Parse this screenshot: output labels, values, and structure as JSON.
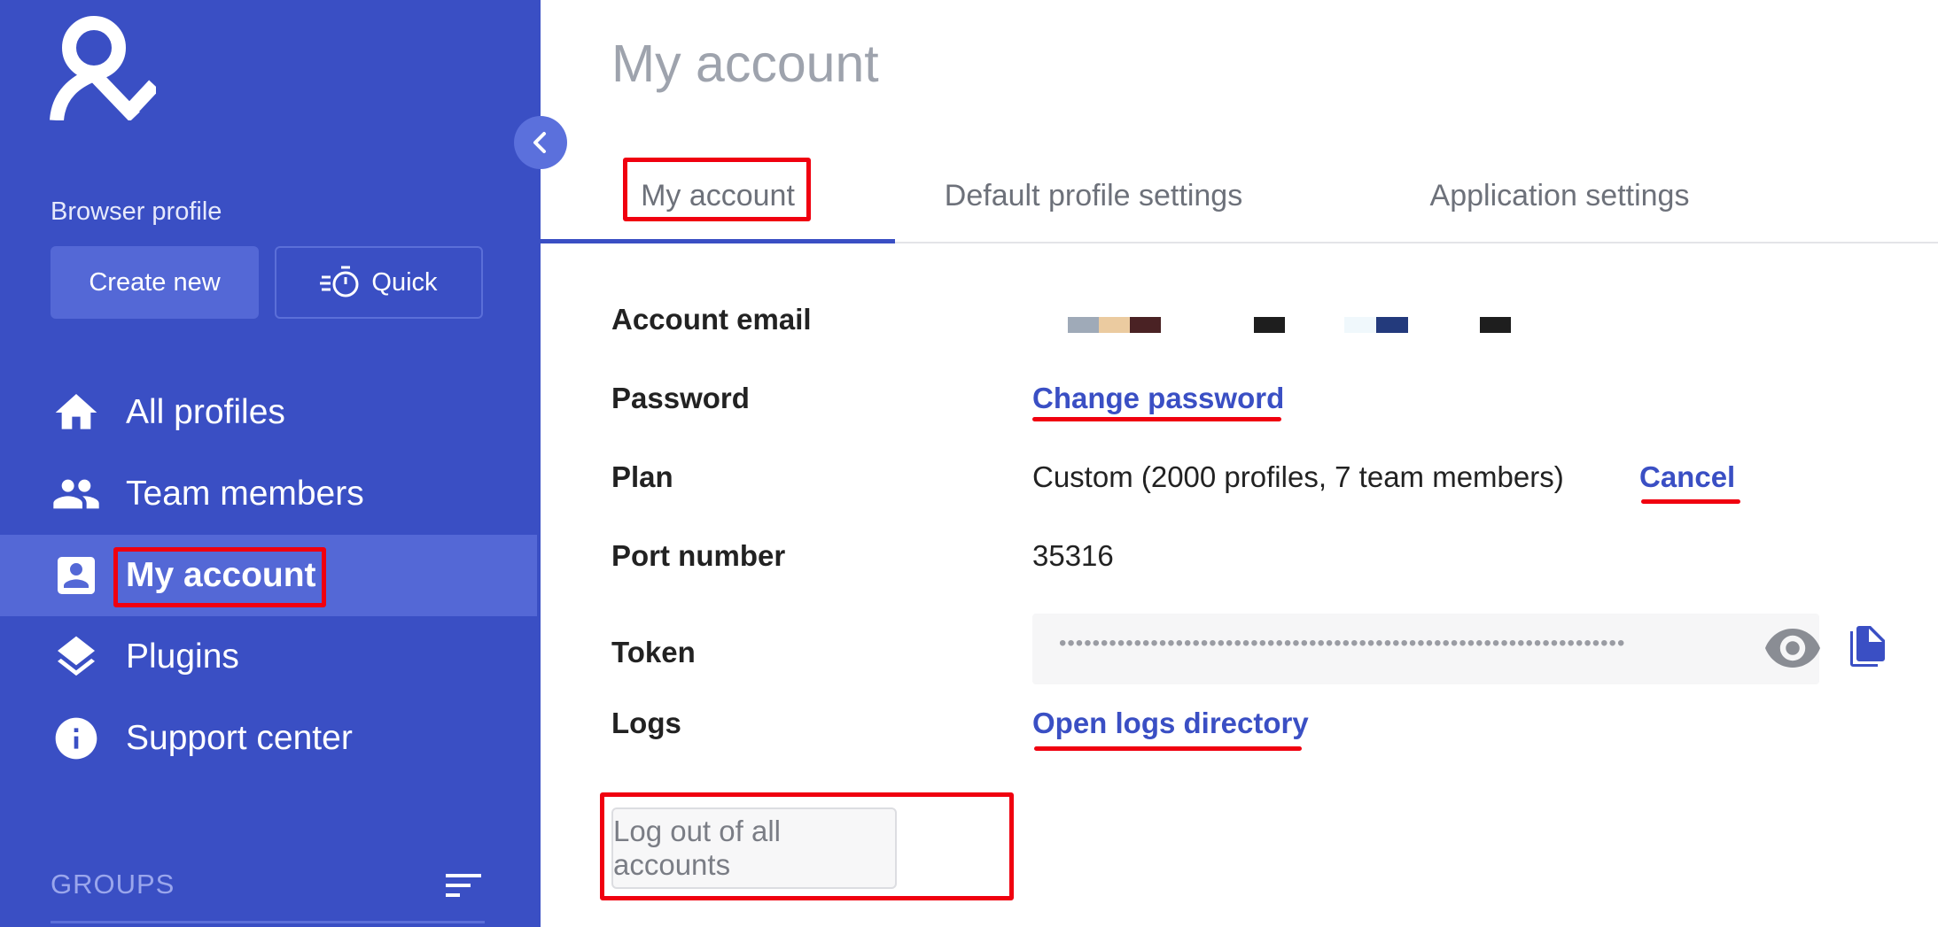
{
  "sidebar": {
    "section_label": "Browser profile",
    "create_new_label": "Create new",
    "quick_label": "Quick",
    "nav": [
      {
        "label": "All profiles",
        "icon": "home-icon"
      },
      {
        "label": "Team members",
        "icon": "people-icon"
      },
      {
        "label": "My account",
        "icon": "account-box-icon",
        "active": true
      },
      {
        "label": "Plugins",
        "icon": "layers-icon"
      },
      {
        "label": "Support center",
        "icon": "info-icon"
      }
    ],
    "groups_label": "GROUPS"
  },
  "main": {
    "page_title": "My account",
    "tabs": [
      {
        "label": "My account",
        "active": true
      },
      {
        "label": "Default profile settings"
      },
      {
        "label": "Application settings"
      }
    ],
    "rows": {
      "email_label": "Account email",
      "password_label": "Password",
      "password_link": "Change password",
      "plan_label": "Plan",
      "plan_value": "Custom (2000 profiles, 7 team members)",
      "plan_cancel": "Cancel",
      "port_label": "Port number",
      "port_value": "35316",
      "token_label": "Token",
      "token_masked": "••••••••••••••••••••••••••••••••••••••••••••••••••••••••••••••••••••",
      "logs_label": "Logs",
      "logs_link": "Open logs directory"
    },
    "logout_label": "Log out of all accounts"
  },
  "colors": {
    "sidebar_bg": "#3a4fc4",
    "accent": "#3a4fc4",
    "annotation": "#f0000f"
  }
}
